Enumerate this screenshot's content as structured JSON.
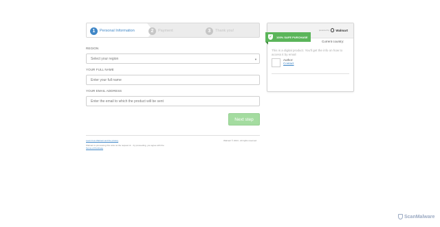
{
  "steps": [
    {
      "number": "1",
      "label": "Personal Information"
    },
    {
      "number": "2",
      "label": "Payment"
    },
    {
      "number": "3",
      "label": "Thank you!"
    }
  ],
  "form": {
    "region_label": "REGION",
    "region_value": "Select your region",
    "name_label": "YOUR FULL NAME",
    "name_placeholder": "Enter your full name",
    "email_label": "YOUR EMAIL ADDRESS",
    "email_placeholder": "Enter the email to which the product will be sent",
    "next_button": "Next step"
  },
  "footer": {
    "links_text": "Learn how Walmart and the privacy",
    "notice": "Walmart is processing this order at the request of... by proceeding, you agree with the",
    "terms_link": "Terms of Purchase",
    "copyright": "Walmart © 2024 - All rights reserved"
  },
  "panel": {
    "powered_by": "powered by",
    "brand": "Walmart",
    "badge": "100% SAFE PURCHASE",
    "current_country": "Current country:",
    "description": "This is a digital product. You'll get the info on how to access it by email",
    "author_label": "Author:",
    "contact_link": "Contact"
  },
  "watermark": "ScanMalware"
}
